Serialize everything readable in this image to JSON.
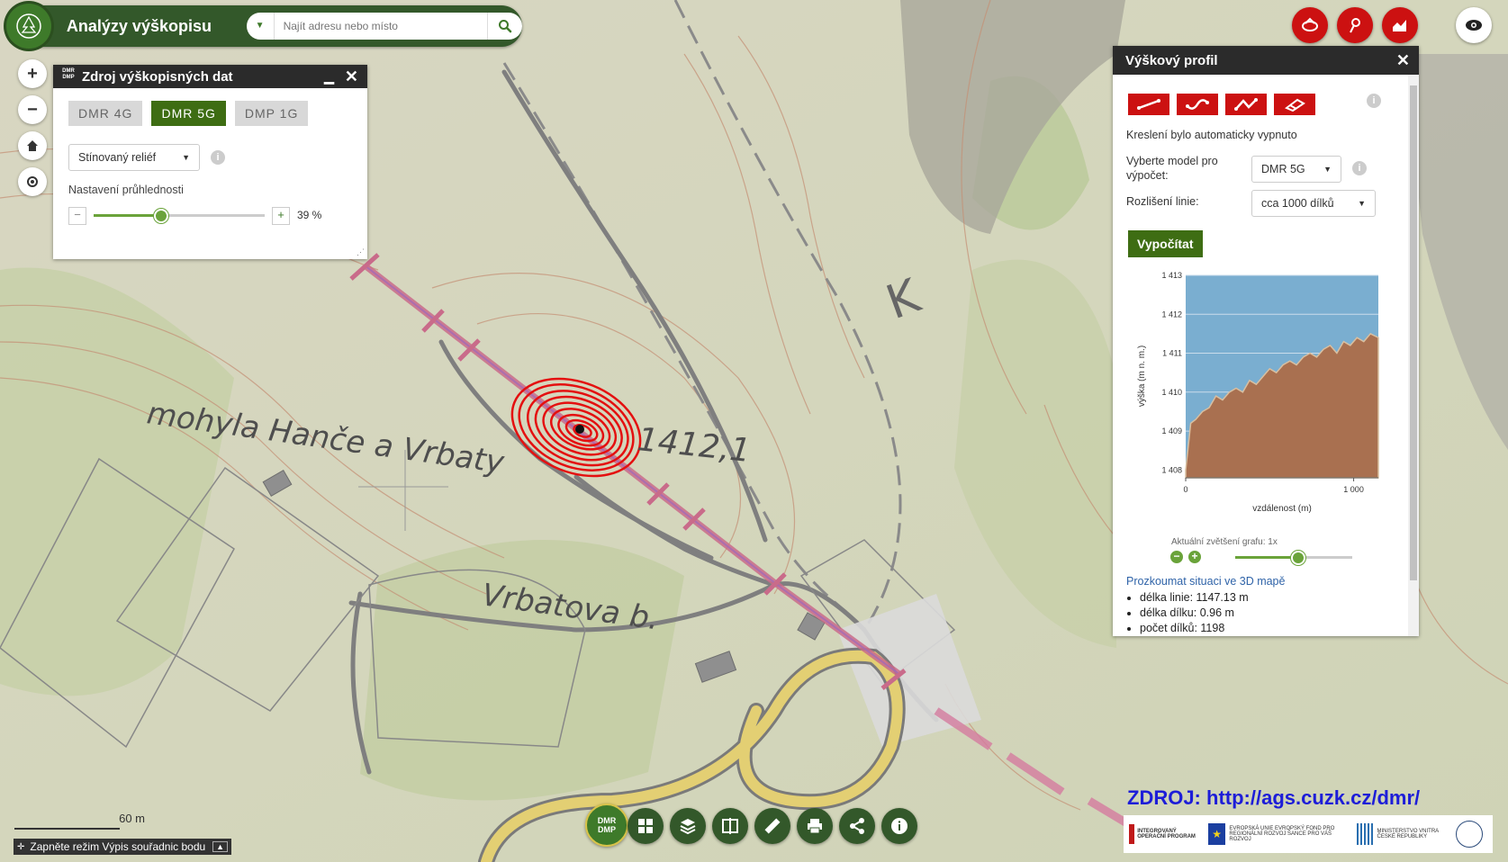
{
  "header": {
    "title": "Analýzy výškopisu",
    "search_placeholder": "Najít adresu nebo místo"
  },
  "map": {
    "label_mohyla": "mohyla Hanče a Vrbaty",
    "label_elevation": "1412,1",
    "label_vrbatova": "Vrbatova b.",
    "label_k": "K",
    "scale_label": "60 m",
    "status_text": "Zapněte režim Výpis souřadnic bodu"
  },
  "source_panel": {
    "badge_line1": "DMR",
    "badge_line2": "DMP",
    "title": "Zdroj výškopisných dat",
    "tabs": [
      "DMR 4G",
      "DMR 5G",
      "DMP 1G"
    ],
    "active_tab": "DMR 5G",
    "layer_select": "Stínovaný reliéf",
    "transparency_label": "Nastavení průhlednosti",
    "transparency_value": "39 %",
    "transparency_fraction": 0.39
  },
  "profile_panel": {
    "title": "Výškový profil",
    "drawing_status": "Kreslení bylo automaticky vypnuto",
    "model_label": "Vyberte model pro výpočet:",
    "model_value": "DMR 5G",
    "resolution_label": "Rozlišení linie:",
    "resolution_value": "cca 1000 dílků",
    "compute_button": "Vypočítat",
    "zoom_label": "Aktuální zvětšení grafu: 1x",
    "zoom_fraction": 0.53,
    "link_3d": "Prozkoumat situaci ve 3D mapě",
    "stats": [
      "délka linie: 1147.13 m",
      "délka dílku: 0.96 m",
      "počet dílků: 1198"
    ]
  },
  "chart_data": {
    "type": "area",
    "xlabel": "vzdálenost (m)",
    "ylabel": "výška (m n. m.)",
    "x_ticks": [
      "0",
      "1 000"
    ],
    "y_ticks": [
      "1 413",
      "1 412",
      "1 411",
      "1 410",
      "1 409",
      "1 408"
    ],
    "xlim": [
      0,
      1147
    ],
    "ylim": [
      1407.8,
      1413.0
    ],
    "x": [
      0,
      30,
      60,
      100,
      140,
      180,
      220,
      260,
      300,
      340,
      380,
      420,
      460,
      500,
      540,
      580,
      620,
      660,
      700,
      740,
      780,
      820,
      860,
      900,
      940,
      980,
      1020,
      1060,
      1100,
      1147
    ],
    "y": [
      1408.0,
      1409.2,
      1409.3,
      1409.5,
      1409.6,
      1409.9,
      1409.8,
      1410.0,
      1410.1,
      1410.0,
      1410.3,
      1410.2,
      1410.4,
      1410.6,
      1410.5,
      1410.7,
      1410.8,
      1410.7,
      1410.9,
      1411.0,
      1410.9,
      1411.1,
      1411.2,
      1411.0,
      1411.3,
      1411.2,
      1411.4,
      1411.3,
      1411.5,
      1411.4
    ],
    "grid": true,
    "colors": {
      "sky": "#7aaed0",
      "fill": "#a97050",
      "line": "#d9bfa0"
    }
  },
  "colors": {
    "header_bg": "#33582a",
    "accent_red": "#cc1111",
    "accent_green": "#3e6d13",
    "profile_line": "#c96b8a",
    "contour_red": "#e41010"
  },
  "source_credit": "ZDROJ: http://ags.cuzk.cz/dmr/",
  "logos": {
    "eu_text": "EVROPSKÁ UNIE EVROPSKÝ FOND PRO REGIONÁLNÍ ROZVOJ ŠANCE PRO VÁŠ ROZVOJ",
    "iop_text": "INTEGROVANÝ OPERAČNÍ PROGRAM",
    "mv_text": "MINISTERSTVO VNITRA ČESKÉ REPUBLIKY"
  },
  "icons": {
    "top_right": [
      "3d-view-icon",
      "point-icon",
      "profile-icon",
      "eye-icon"
    ],
    "toolbar": [
      "dmr-dmp-icon",
      "grid-icon",
      "layers-icon",
      "compare-icon",
      "measure-icon",
      "print-icon",
      "share-icon",
      "info-icon"
    ],
    "profile_tools": [
      "line-tool-icon",
      "curve-tool-icon",
      "polyline-tool-icon",
      "eraser-icon"
    ]
  }
}
